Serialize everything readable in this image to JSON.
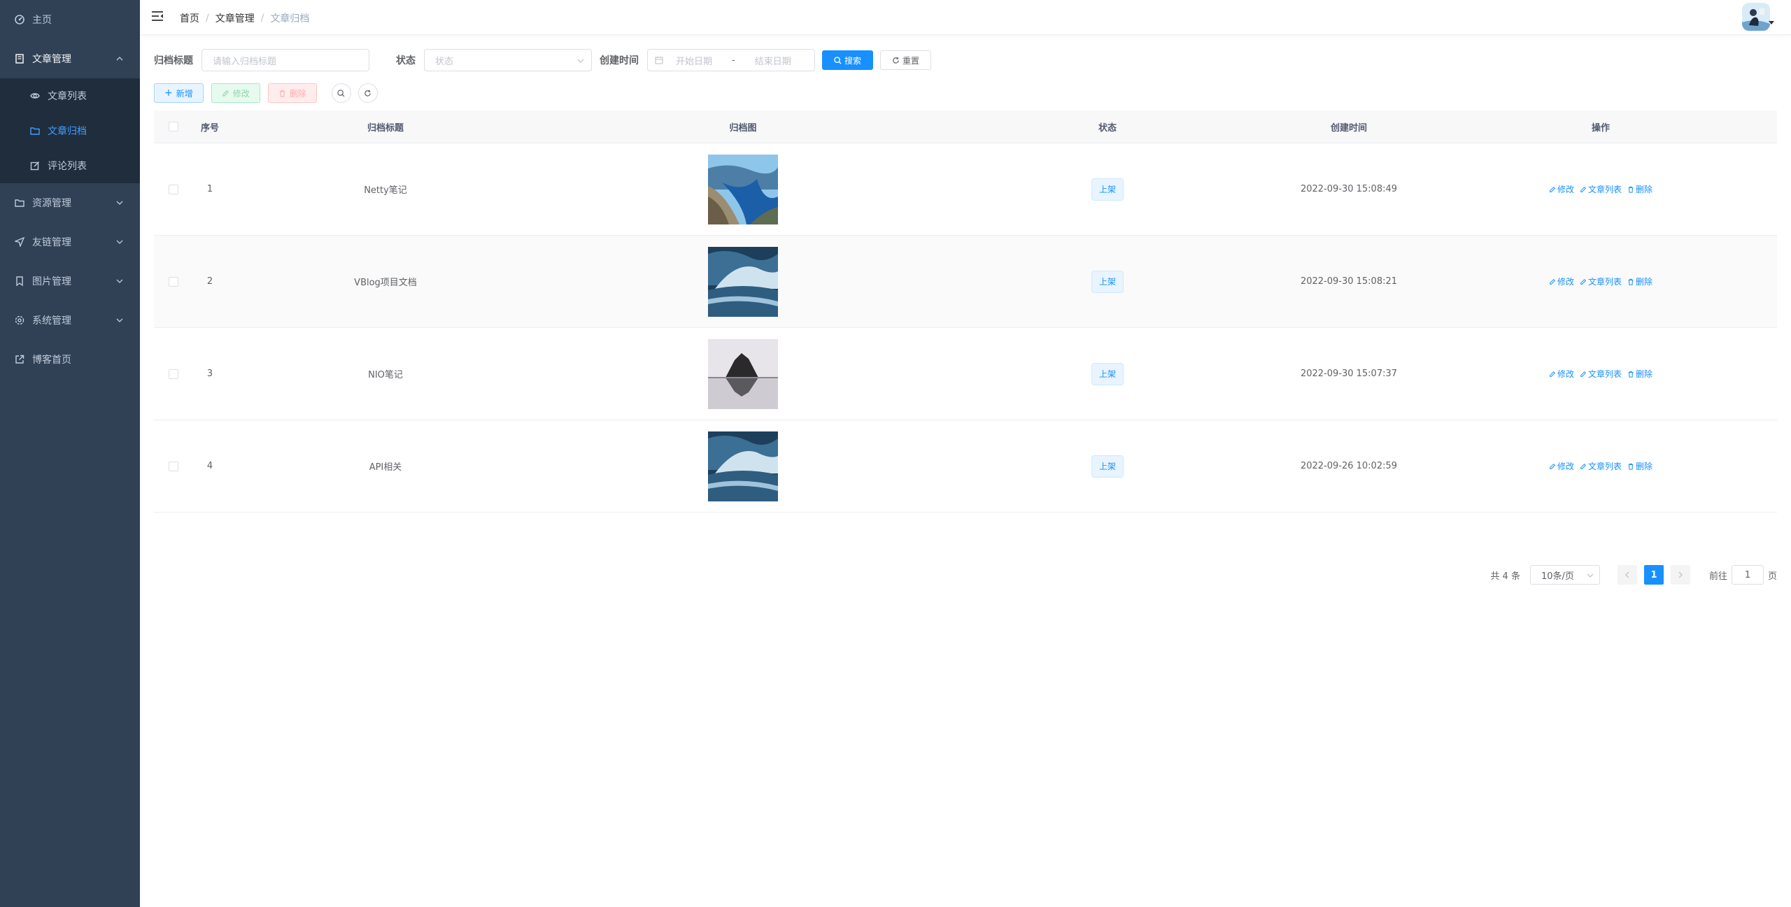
{
  "sidebar": {
    "items": [
      {
        "label": "主页",
        "icon": "dashboard-icon"
      },
      {
        "label": "文章管理",
        "icon": "document-icon",
        "open": true,
        "children": [
          {
            "label": "文章列表",
            "icon": "eye-icon"
          },
          {
            "label": "文章归档",
            "icon": "folder-icon",
            "active": true
          },
          {
            "label": "评论列表",
            "icon": "edit-icon"
          }
        ]
      },
      {
        "label": "资源管理",
        "icon": "folder-icon"
      },
      {
        "label": "友链管理",
        "icon": "send-icon"
      },
      {
        "label": "图片管理",
        "icon": "bookmark-icon"
      },
      {
        "label": "系统管理",
        "icon": "gear-icon"
      },
      {
        "label": "博客首页",
        "icon": "external-link-icon"
      }
    ]
  },
  "header": {
    "breadcrumb": [
      "首页",
      "文章管理",
      "文章归档"
    ]
  },
  "search": {
    "title_label": "归档标题",
    "title_placeholder": "请输入归档标题",
    "status_label": "状态",
    "status_placeholder": "状态",
    "time_label": "创建时间",
    "start_placeholder": "开始日期",
    "range_sep": "-",
    "end_placeholder": "结束日期",
    "search_btn": "搜索",
    "reset_btn": "重置"
  },
  "toolbar": {
    "add": "新增",
    "edit": "修改",
    "delete": "删除"
  },
  "table": {
    "headers": [
      "序号",
      "归档标题",
      "归档图",
      "状态",
      "创建时间",
      "操作"
    ],
    "rows": [
      {
        "index": "1",
        "title": "Netty笔记",
        "status": "上架",
        "time": "2022-09-30 15:08:49",
        "image": "fjord"
      },
      {
        "index": "2",
        "title": "VBlog项目文档",
        "status": "上架",
        "time": "2022-09-30 15:08:21",
        "image": "wave"
      },
      {
        "index": "3",
        "title": "NIO笔记",
        "status": "上架",
        "time": "2022-09-30 15:07:37",
        "image": "rock"
      },
      {
        "index": "4",
        "title": "API相关",
        "status": "上架",
        "time": "2022-09-26 10:02:59",
        "image": "wave"
      }
    ],
    "ops": [
      "修改",
      "文章列表",
      "删除"
    ]
  },
  "pagination": {
    "total": "共 4 条",
    "page_size": "10条/页",
    "current": "1",
    "goto_label": "前往",
    "goto_value": "1",
    "page_suffix": "页"
  },
  "colors": {
    "sidebar_bg": "#304156",
    "submenu_bg": "#1f2d3d",
    "primary": "#1890ff"
  }
}
